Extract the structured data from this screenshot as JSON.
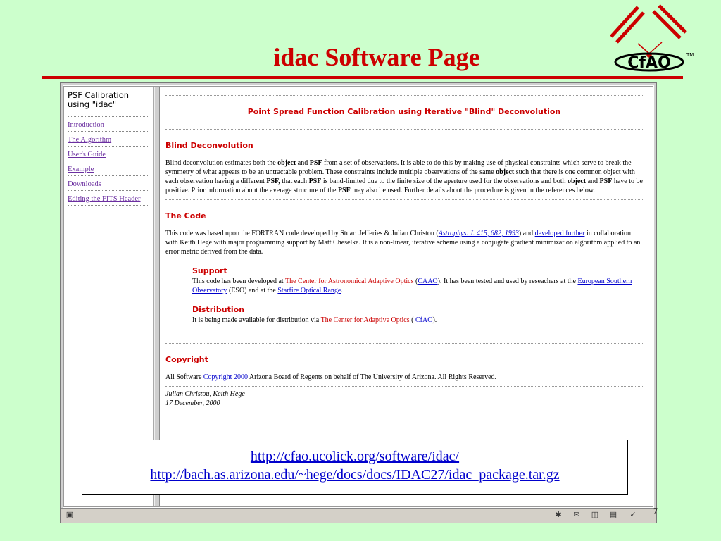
{
  "slide": {
    "title": "idac Software Page",
    "page_number": "7"
  },
  "logo": {
    "text": "CfAO",
    "tm": "TM"
  },
  "nav": {
    "title": "PSF Calibration using \"idac\"",
    "items": [
      "Introduction",
      "The Algorithm",
      "User's Guide",
      "Example",
      "Downloads",
      "Editing the FITS Header"
    ]
  },
  "content": {
    "banner": "Point Spread Function Calibration using  Iterative \"Blind\" Deconvolution",
    "blind": {
      "heading": "Blind Deconvolution",
      "t1": "Blind deconvolution estimates both the ",
      "object": "object",
      "and": "and",
      "psf": "PSF",
      "t2": " from a set of  observations.  It is able to do this by making use of physical constraints which serve to break the symmetry of what appears to be an untractable problem.  These constraints include multiple observations of the same ",
      "t3": " such that there is one common object with each observation having a different ",
      "psf_comma": "PSF,",
      "t4": "  that each ",
      "t5": " is band-limited due to the finite size of the aperture used for the observations and both ",
      "t6": " have to be positive.   Prior information about the average structure of the ",
      "t7": " may also be used.  Further details about the procedure is given in the references below."
    },
    "code": {
      "heading": "The Code",
      "t1": "This code was based upon the FORTRAN code developed by Stuart Jefferies & Julian Christou (",
      "ref": "Astrophys. J. 415, 682, 1993",
      "t2": ") and ",
      "link_further": "developed further",
      "t3": " in collaboration with Keith Hege with major programming support by Matt Cheselka. It is a non-linear, iterative scheme using a conjugate gradient minimization algorithm applied to an error metric derived from the data."
    },
    "support": {
      "heading": "Support",
      "t1": "This code has been developed at ",
      "center": "The Center for Astronomical Adaptive Optics",
      "t2": " (",
      "caao": "CAAO",
      "t3": "). It has been tested and used by reseachers at the ",
      "eso_link": "European Southern Observatory",
      "t4": " (ESO) and at the ",
      "sor_link": "Starfire Optical Range",
      "t5": "."
    },
    "distribution": {
      "heading": "Distribution",
      "t1": "It is being made available for distribution via ",
      "center": "The Center for Adaptive Optics",
      "t2": " ( ",
      "cfao": "CfAO",
      "t3": ")."
    },
    "copyright": {
      "heading": "Copyright",
      "t1": "All Software ",
      "link": "Copyright 2000",
      "t2": " Arizona Board of Regents on behalf of The University of Arizona. All Rights Reserved."
    },
    "signature": {
      "authors": "Julian Christou, Keith Hege",
      "date": "17 December, 2000"
    }
  },
  "urls": [
    "http://cfao.ucolick.org/software/idac/",
    "http://bach.as.arizona.edu/~hege/docs/docs/IDAC27/idac_package.tar.gz"
  ],
  "colors": {
    "background": "#ccffcc",
    "accent": "#cc0000",
    "link": "#0000cc",
    "visited": "#6b2fa0"
  }
}
